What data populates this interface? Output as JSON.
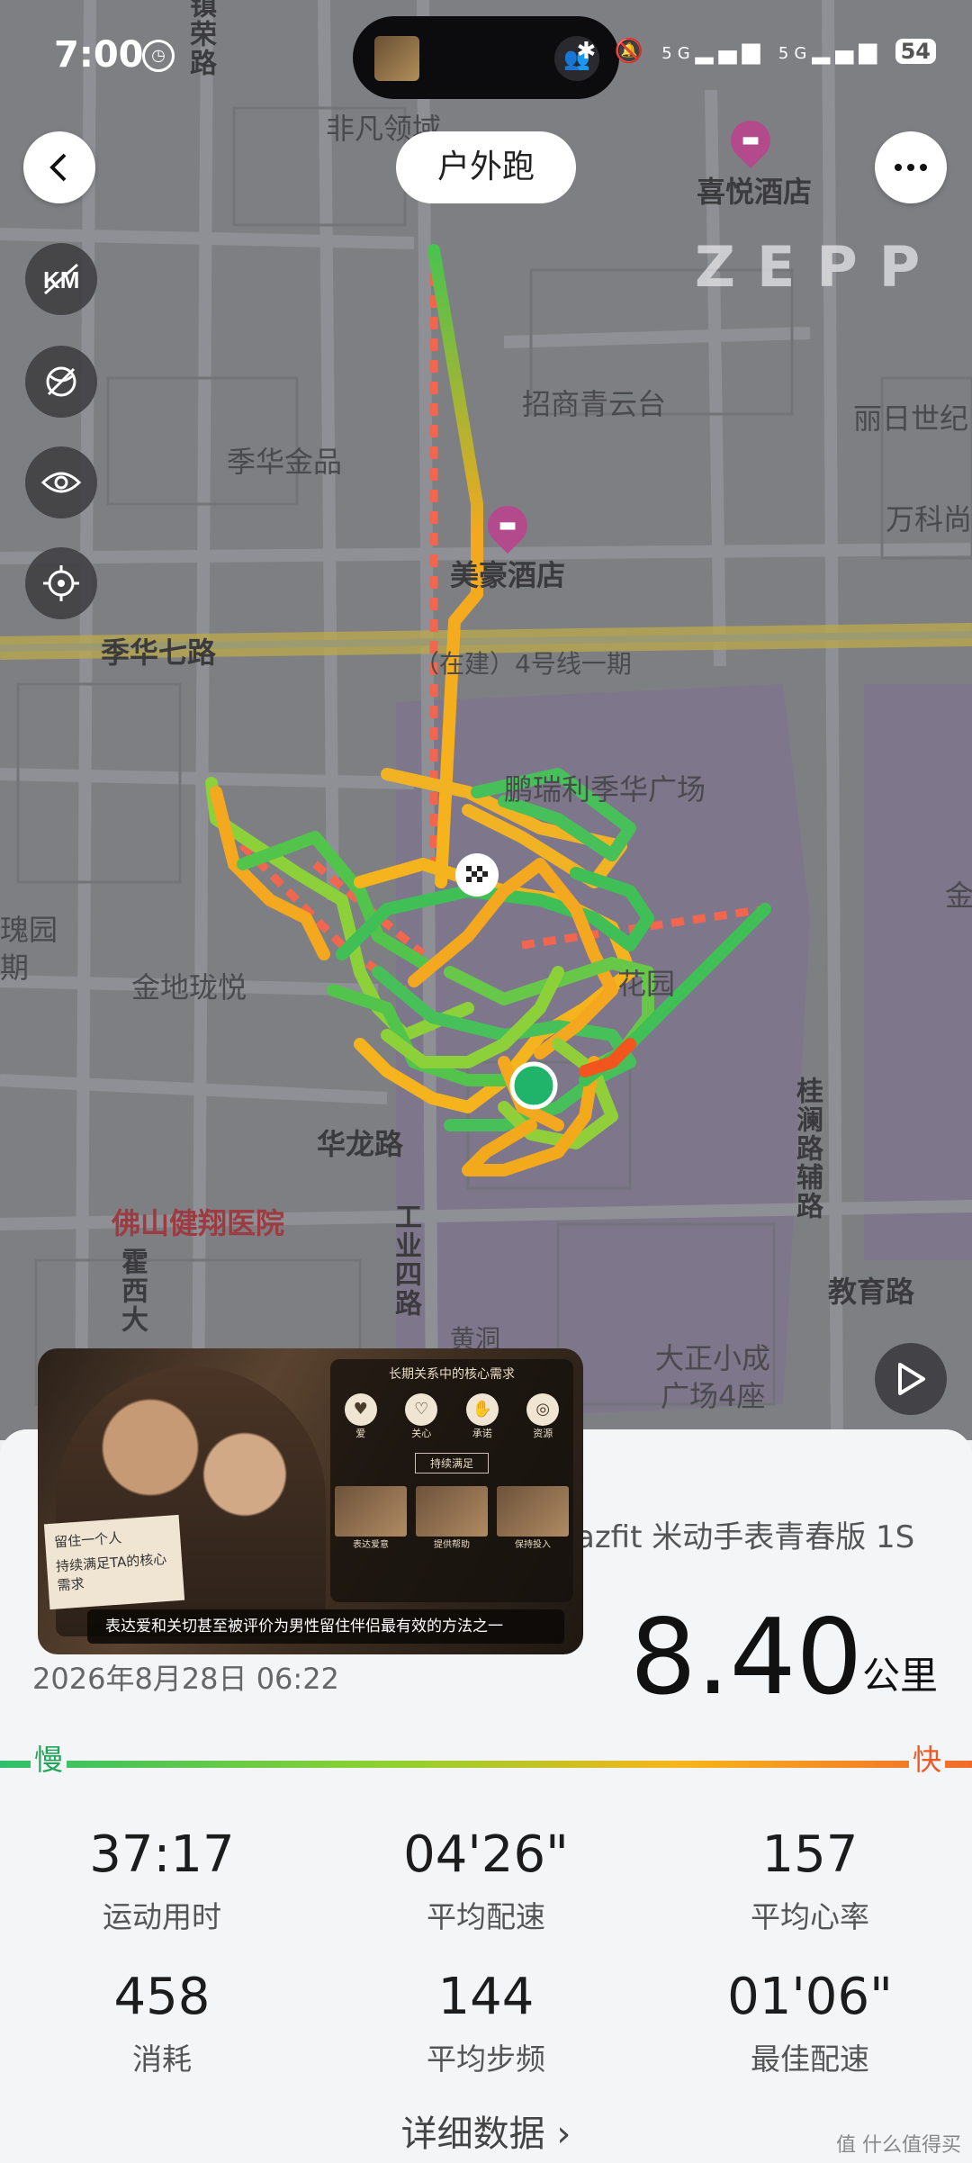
{
  "status_bar": {
    "time": "7:00",
    "network": "5G",
    "battery": "54"
  },
  "header": {
    "title": "户外跑"
  },
  "map": {
    "labels": {
      "road_zhen": "镇荣路",
      "feifan": "非凡领域",
      "xiyue_hotel": "喜悦酒店",
      "zhaoshang": "招商青云台",
      "jihua_jinpin": "季华金品",
      "lirishiji": "丽日世纪",
      "wankesi": "万科尚",
      "meihao_hotel": "美豪酒店",
      "jihua7": "季华七路",
      "metro": "（在建）4号线一期",
      "plaza": "鹏瑞利季华广场",
      "guiyuan": "瑰园",
      "guiyuan2": "期",
      "jindi": "金地珑悦",
      "huayuan": "花园",
      "jin_right": "金",
      "hualong": "华龙路",
      "guilan": "桂澜路辅路",
      "hospital": "佛山健翔医院",
      "gongye4": "工业四路",
      "huoxi": "霍西大",
      "huangdong": "黄洞",
      "jiaoyu": "教育路",
      "dazheng": "大正小成",
      "dazheng2": "广场4座"
    },
    "brand": "ZEPP"
  },
  "ad": {
    "panel_title": "长期关系中的核心需求",
    "icons": [
      "爱",
      "关心",
      "承诺",
      "资源"
    ],
    "box": "持续满足",
    "photos": [
      "表达爱意",
      "提供帮助",
      "保持投入"
    ],
    "note_line1": "留住一个人",
    "note_line2": "持续满足TA的核心需求",
    "caption": "表达爱和关切甚至被评价为男性留住伴侣最有效的方法之一"
  },
  "summary": {
    "device": "azfit 米动手表青春版 1S",
    "datetime": "2026年8月28日 06:22",
    "distance": "8.40",
    "distance_unit": "公里",
    "slow_label": "慢",
    "fast_label": "快",
    "stats": [
      {
        "value": "37:17",
        "label": "运动用时"
      },
      {
        "value": "04'26\"",
        "label": "平均配速"
      },
      {
        "value": "157",
        "label": "平均心率"
      },
      {
        "value": "458",
        "label": "消耗"
      },
      {
        "value": "144",
        "label": "平均步频"
      },
      {
        "value": "01'06\"",
        "label": "最佳配速"
      }
    ],
    "detail_link": "详细数据 ›"
  },
  "watermark": "值 什么值得买",
  "colors": {
    "slow": "#2fbf6a",
    "mid": "#f6b51b",
    "fast": "#f26a2a",
    "map_bg": "#7e7f83"
  }
}
